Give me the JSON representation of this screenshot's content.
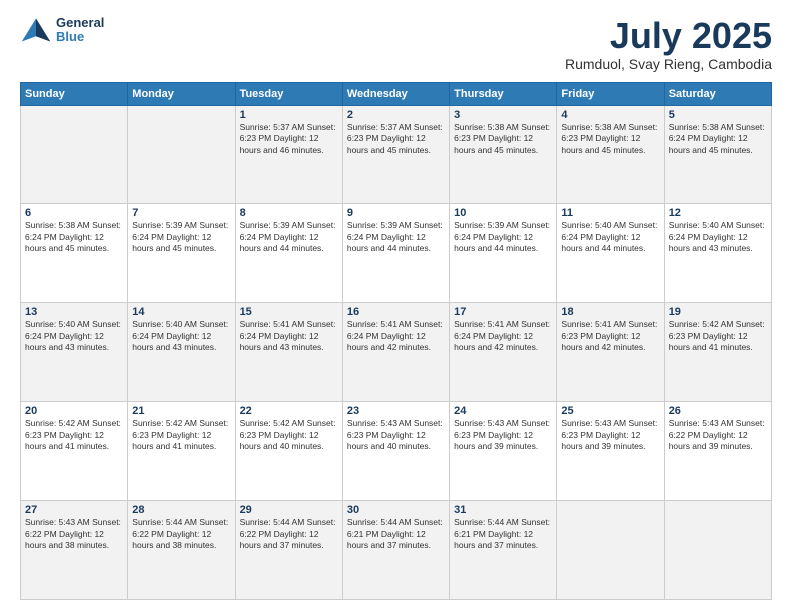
{
  "logo": {
    "line1": "General",
    "line2": "Blue"
  },
  "title": "July 2025",
  "subtitle": "Rumduol, Svay Rieng, Cambodia",
  "days_of_week": [
    "Sunday",
    "Monday",
    "Tuesday",
    "Wednesday",
    "Thursday",
    "Friday",
    "Saturday"
  ],
  "weeks": [
    [
      {
        "day": "",
        "detail": ""
      },
      {
        "day": "",
        "detail": ""
      },
      {
        "day": "1",
        "detail": "Sunrise: 5:37 AM\nSunset: 6:23 PM\nDaylight: 12 hours and 46 minutes."
      },
      {
        "day": "2",
        "detail": "Sunrise: 5:37 AM\nSunset: 6:23 PM\nDaylight: 12 hours and 45 minutes."
      },
      {
        "day": "3",
        "detail": "Sunrise: 5:38 AM\nSunset: 6:23 PM\nDaylight: 12 hours and 45 minutes."
      },
      {
        "day": "4",
        "detail": "Sunrise: 5:38 AM\nSunset: 6:23 PM\nDaylight: 12 hours and 45 minutes."
      },
      {
        "day": "5",
        "detail": "Sunrise: 5:38 AM\nSunset: 6:24 PM\nDaylight: 12 hours and 45 minutes."
      }
    ],
    [
      {
        "day": "6",
        "detail": "Sunrise: 5:38 AM\nSunset: 6:24 PM\nDaylight: 12 hours and 45 minutes."
      },
      {
        "day": "7",
        "detail": "Sunrise: 5:39 AM\nSunset: 6:24 PM\nDaylight: 12 hours and 45 minutes."
      },
      {
        "day": "8",
        "detail": "Sunrise: 5:39 AM\nSunset: 6:24 PM\nDaylight: 12 hours and 44 minutes."
      },
      {
        "day": "9",
        "detail": "Sunrise: 5:39 AM\nSunset: 6:24 PM\nDaylight: 12 hours and 44 minutes."
      },
      {
        "day": "10",
        "detail": "Sunrise: 5:39 AM\nSunset: 6:24 PM\nDaylight: 12 hours and 44 minutes."
      },
      {
        "day": "11",
        "detail": "Sunrise: 5:40 AM\nSunset: 6:24 PM\nDaylight: 12 hours and 44 minutes."
      },
      {
        "day": "12",
        "detail": "Sunrise: 5:40 AM\nSunset: 6:24 PM\nDaylight: 12 hours and 43 minutes."
      }
    ],
    [
      {
        "day": "13",
        "detail": "Sunrise: 5:40 AM\nSunset: 6:24 PM\nDaylight: 12 hours and 43 minutes."
      },
      {
        "day": "14",
        "detail": "Sunrise: 5:40 AM\nSunset: 6:24 PM\nDaylight: 12 hours and 43 minutes."
      },
      {
        "day": "15",
        "detail": "Sunrise: 5:41 AM\nSunset: 6:24 PM\nDaylight: 12 hours and 43 minutes."
      },
      {
        "day": "16",
        "detail": "Sunrise: 5:41 AM\nSunset: 6:24 PM\nDaylight: 12 hours and 42 minutes."
      },
      {
        "day": "17",
        "detail": "Sunrise: 5:41 AM\nSunset: 6:24 PM\nDaylight: 12 hours and 42 minutes."
      },
      {
        "day": "18",
        "detail": "Sunrise: 5:41 AM\nSunset: 6:23 PM\nDaylight: 12 hours and 42 minutes."
      },
      {
        "day": "19",
        "detail": "Sunrise: 5:42 AM\nSunset: 6:23 PM\nDaylight: 12 hours and 41 minutes."
      }
    ],
    [
      {
        "day": "20",
        "detail": "Sunrise: 5:42 AM\nSunset: 6:23 PM\nDaylight: 12 hours and 41 minutes."
      },
      {
        "day": "21",
        "detail": "Sunrise: 5:42 AM\nSunset: 6:23 PM\nDaylight: 12 hours and 41 minutes."
      },
      {
        "day": "22",
        "detail": "Sunrise: 5:42 AM\nSunset: 6:23 PM\nDaylight: 12 hours and 40 minutes."
      },
      {
        "day": "23",
        "detail": "Sunrise: 5:43 AM\nSunset: 6:23 PM\nDaylight: 12 hours and 40 minutes."
      },
      {
        "day": "24",
        "detail": "Sunrise: 5:43 AM\nSunset: 6:23 PM\nDaylight: 12 hours and 39 minutes."
      },
      {
        "day": "25",
        "detail": "Sunrise: 5:43 AM\nSunset: 6:23 PM\nDaylight: 12 hours and 39 minutes."
      },
      {
        "day": "26",
        "detail": "Sunrise: 5:43 AM\nSunset: 6:22 PM\nDaylight: 12 hours and 39 minutes."
      }
    ],
    [
      {
        "day": "27",
        "detail": "Sunrise: 5:43 AM\nSunset: 6:22 PM\nDaylight: 12 hours and 38 minutes."
      },
      {
        "day": "28",
        "detail": "Sunrise: 5:44 AM\nSunset: 6:22 PM\nDaylight: 12 hours and 38 minutes."
      },
      {
        "day": "29",
        "detail": "Sunrise: 5:44 AM\nSunset: 6:22 PM\nDaylight: 12 hours and 37 minutes."
      },
      {
        "day": "30",
        "detail": "Sunrise: 5:44 AM\nSunset: 6:21 PM\nDaylight: 12 hours and 37 minutes."
      },
      {
        "day": "31",
        "detail": "Sunrise: 5:44 AM\nSunset: 6:21 PM\nDaylight: 12 hours and 37 minutes."
      },
      {
        "day": "",
        "detail": ""
      },
      {
        "day": "",
        "detail": ""
      }
    ]
  ]
}
